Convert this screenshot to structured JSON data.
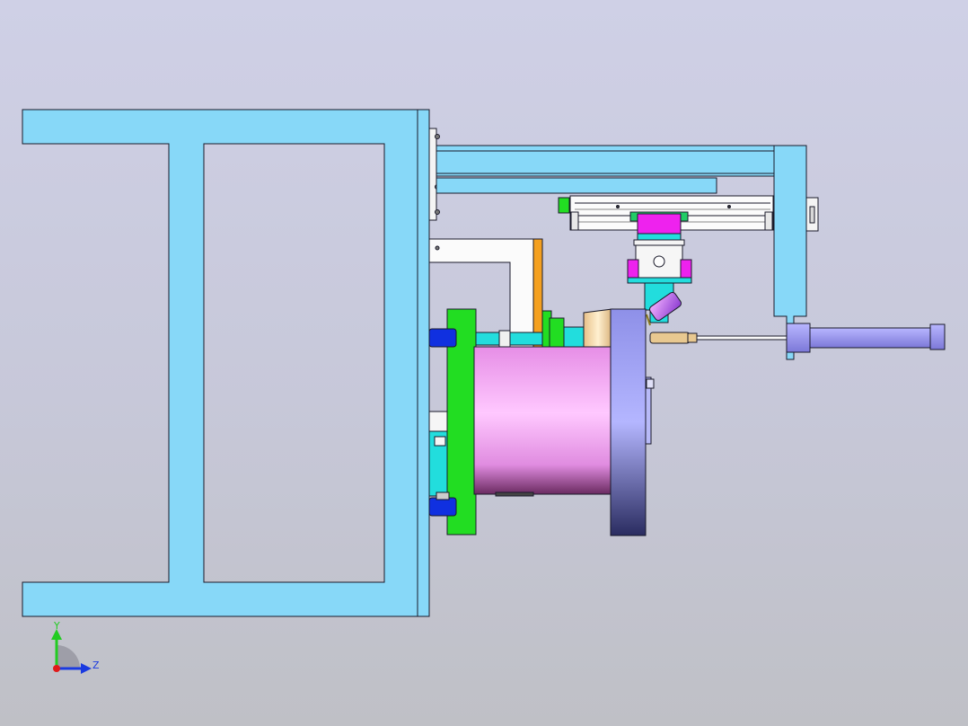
{
  "viewport": {
    "background_top": "#cfd0e6",
    "background_bottom": "#bfc0c6"
  },
  "colors": {
    "frame": "#87d8f8",
    "outline": "#1a1a2a",
    "plate_green": "#22dd22",
    "cylinder_pink": "#f0a8f0",
    "flange_blue": "#9a9cf0",
    "magenta": "#ee22ee",
    "cyan": "#22dddd",
    "bolt_blue": "#1030e0",
    "orange": "#f4a020",
    "rod_tan": "#e8c890",
    "cylinder_purple": "#9a96f0"
  },
  "triad": {
    "y_label": "Y",
    "z_label": "Z",
    "y_color": "#22cc22",
    "z_color": "#1a3ae0",
    "origin_color": "#e01a1a"
  }
}
